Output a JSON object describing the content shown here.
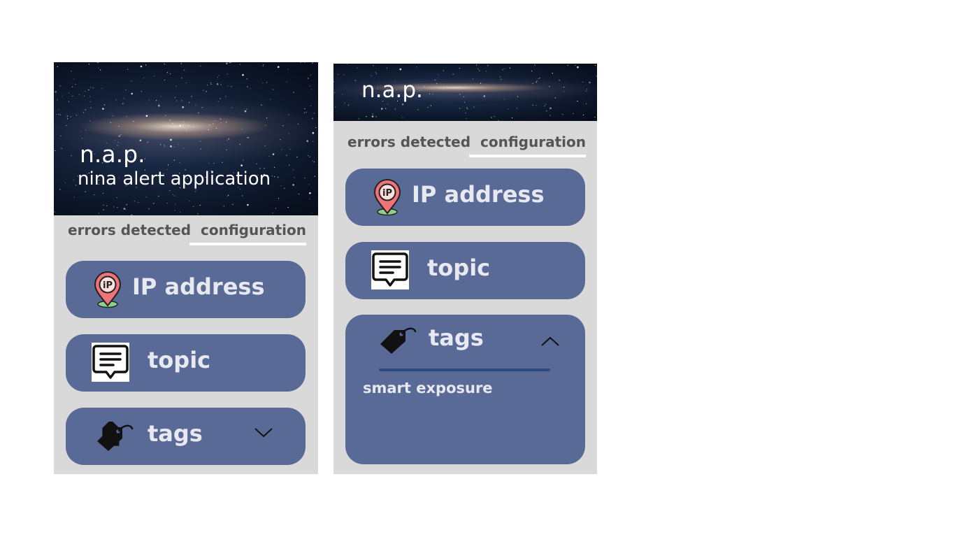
{
  "screens": [
    {
      "hero": {
        "title": "n.a.p.",
        "subtitle": "nina alert application"
      },
      "tabs": {
        "errors": "errors detected",
        "configuration": "configuration",
        "active": "configuration"
      },
      "cards": {
        "ip": {
          "label": "IP address",
          "icon": "ip-pin-icon"
        },
        "topic": {
          "label": "topic",
          "icon": "message-icon"
        },
        "tags": {
          "label": "tags",
          "icon": "tag-icon",
          "state": "collapsed",
          "chevron": "chevron-down-icon"
        }
      }
    },
    {
      "hero": {
        "title": "n.a.p."
      },
      "tabs": {
        "errors": "errors detected",
        "configuration": "configuration",
        "active": "configuration"
      },
      "cards": {
        "ip": {
          "label": "IP address",
          "icon": "ip-pin-icon"
        },
        "topic": {
          "label": "topic",
          "icon": "message-icon"
        },
        "tags": {
          "label": "tags",
          "icon": "tag-icon",
          "state": "expanded",
          "chevron": "chevron-up-icon",
          "items": [
            "smart exposure"
          ]
        }
      }
    }
  ],
  "colors": {
    "screen_background": "#d9d9d9",
    "card": "#5a6a96",
    "card_text": "#e8e9f0",
    "tab_text": "#555555",
    "tab_underline": "#ffffff",
    "tags_divider": "#2f4a82"
  }
}
